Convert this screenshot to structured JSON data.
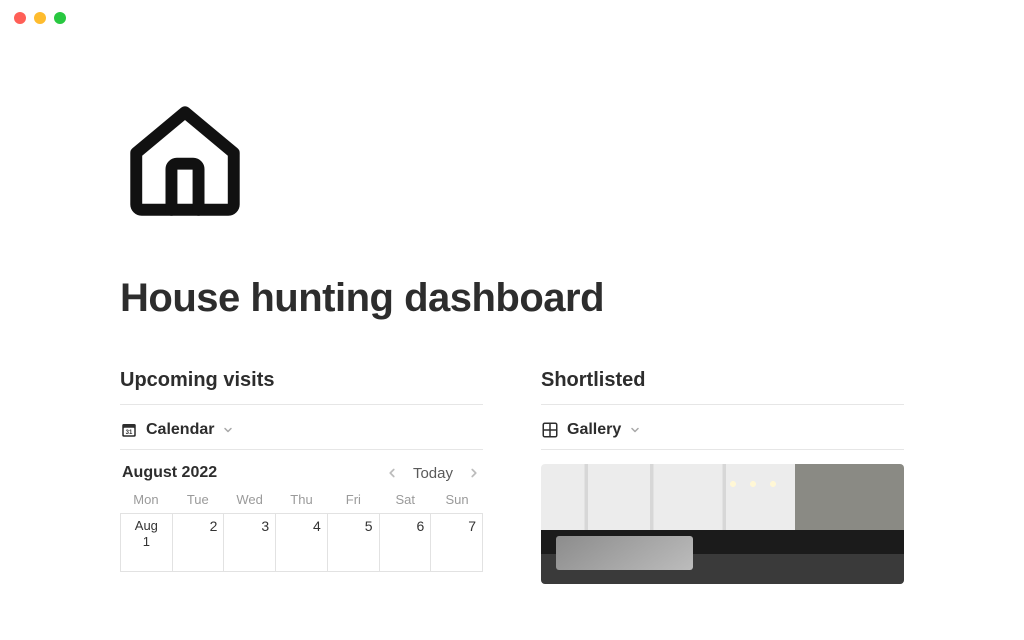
{
  "title": "House hunting dashboard",
  "sections": {
    "visits": {
      "heading": "Upcoming visits",
      "view_label": "Calendar",
      "month_label": "August 2022",
      "today_label": "Today",
      "dow": {
        "mon": "Mon",
        "tue": "Tue",
        "wed": "Wed",
        "thu": "Thu",
        "fri": "Fri",
        "sat": "Sat",
        "sun": "Sun"
      },
      "week1": {
        "d1_month": "Aug",
        "d1_day": "1",
        "d2": "2",
        "d3": "3",
        "d4": "4",
        "d5": "5",
        "d6": "6",
        "d7": "7"
      }
    },
    "shortlist": {
      "heading": "Shortlisted",
      "view_label": "Gallery"
    }
  }
}
